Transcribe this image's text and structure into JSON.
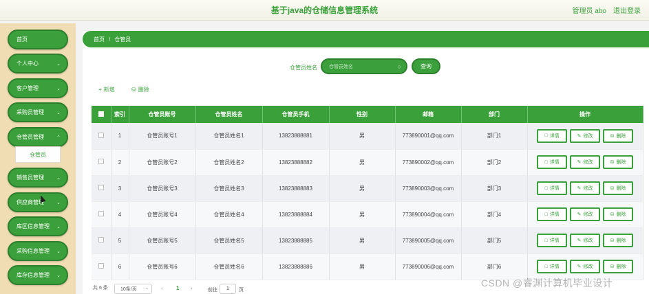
{
  "header": {
    "title": "基于java的仓储信息管理系统",
    "admin": "管理员 abo",
    "logout": "退出登录"
  },
  "sidebar": {
    "items": [
      {
        "label": "首页",
        "chevron": false
      },
      {
        "label": "个人中心",
        "chevron": true
      },
      {
        "label": "客户管理",
        "chevron": true
      },
      {
        "label": "采购员管理",
        "chevron": true
      },
      {
        "label": "仓管员管理",
        "chevron": true
      },
      {
        "label": "销售员管理",
        "chevron": true
      },
      {
        "label": "供应商管理",
        "chevron": true
      },
      {
        "label": "库区信息管理",
        "chevron": true
      },
      {
        "label": "采购信息管理",
        "chevron": true
      },
      {
        "label": "库存信息管理",
        "chevron": true
      }
    ],
    "submenu_label": "仓管员"
  },
  "breadcrumb": {
    "home": "首页",
    "sep": "/",
    "current": "仓管员"
  },
  "search": {
    "label": "仓管员姓名",
    "placeholder": "仓管员姓名",
    "button": "查询"
  },
  "actions": {
    "add": "新增",
    "delete": "删除"
  },
  "table": {
    "columns": [
      "索引",
      "仓管员账号",
      "仓管员姓名",
      "仓管员手机",
      "性别",
      "邮箱",
      "部门",
      "操作"
    ],
    "rows": [
      {
        "index": "1",
        "account": "仓管员账号1",
        "name": "仓管员姓名1",
        "phone": "13823888881",
        "gender": "男",
        "email": "773890001@qq.com",
        "dept": "部门1"
      },
      {
        "index": "2",
        "account": "仓管员账号2",
        "name": "仓管员姓名2",
        "phone": "13823888882",
        "gender": "男",
        "email": "773890002@qq.com",
        "dept": "部门2"
      },
      {
        "index": "3",
        "account": "仓管员账号3",
        "name": "仓管员姓名3",
        "phone": "13823888883",
        "gender": "男",
        "email": "773890003@qq.com",
        "dept": "部门3"
      },
      {
        "index": "4",
        "account": "仓管员账号4",
        "name": "仓管员姓名4",
        "phone": "13823888884",
        "gender": "男",
        "email": "773890004@qq.com",
        "dept": "部门4"
      },
      {
        "index": "5",
        "account": "仓管员账号5",
        "name": "仓管员姓名5",
        "phone": "13823888885",
        "gender": "男",
        "email": "773890005@qq.com",
        "dept": "部门5"
      },
      {
        "index": "6",
        "account": "仓管员账号6",
        "name": "仓管员姓名6",
        "phone": "13823888886",
        "gender": "男",
        "email": "773890006@qq.com",
        "dept": "部门6"
      }
    ],
    "op_labels": {
      "detail": "详情",
      "edit": "修改",
      "delete": "删除"
    }
  },
  "pagination": {
    "total": "共 6 条",
    "page_size": "10条/页",
    "current_page": "1",
    "goto_label": "前往",
    "goto_value": "1",
    "page_suffix": "页"
  },
  "watermark": "CSDN @睿渊计算机毕业设计",
  "colors": {
    "accent": "#3aa03a",
    "sidebar_bg": "#f0ddb3"
  }
}
